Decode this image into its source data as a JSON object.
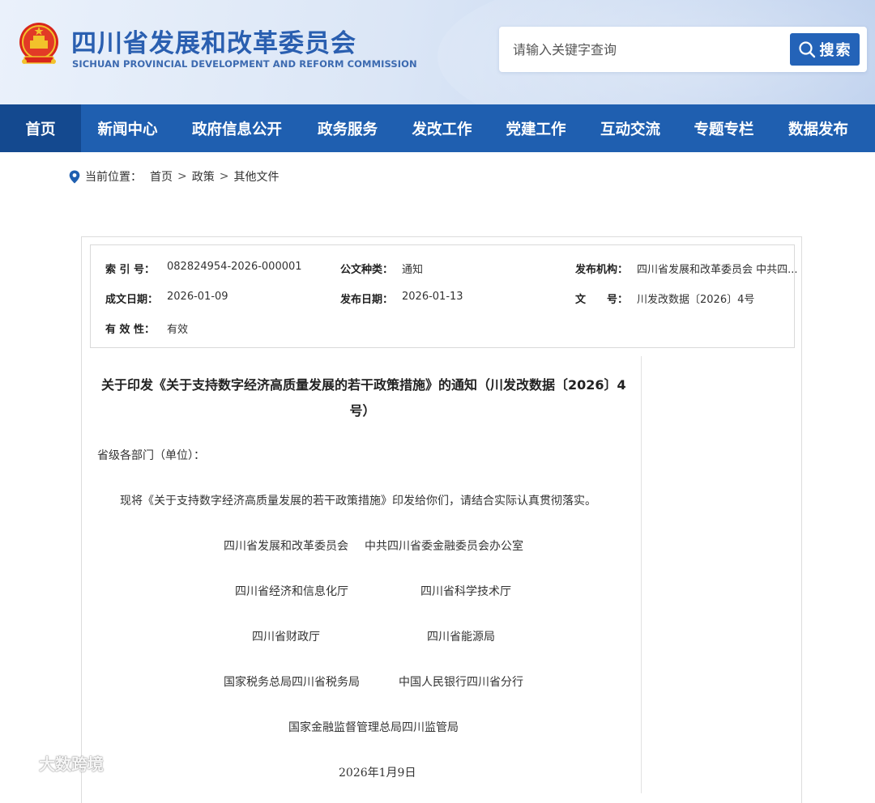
{
  "header": {
    "title": "四川省发展和改革委员会",
    "subtitle": "SICHUAN PROVINCIAL DEVELOPMENT AND REFORM COMMISSION",
    "emblem_icon": "national-emblem-icon",
    "search": {
      "placeholder": "请输入关键字查询",
      "button_label": "搜索"
    }
  },
  "nav": {
    "items": [
      {
        "label": "首页",
        "active": true
      },
      {
        "label": "新闻中心"
      },
      {
        "label": "政府信息公开"
      },
      {
        "label": "政务服务"
      },
      {
        "label": "发改工作"
      },
      {
        "label": "党建工作"
      },
      {
        "label": "互动交流"
      },
      {
        "label": "专题专栏"
      },
      {
        "label": "数据发布"
      }
    ]
  },
  "breadcrumb": {
    "prefix": "当前位置：",
    "items": [
      "首页",
      "政策",
      "其他文件"
    ],
    "separator": ">"
  },
  "meta": {
    "index_no_label": "索 引 号：",
    "index_no": "082824954-2026-000001",
    "doc_type_label": "公文种类：",
    "doc_type": "通知",
    "publisher_label": "发布机构：",
    "publisher": "四川省发展和改革委员会 中共四...",
    "created_label": "成文日期：",
    "created": "2026-01-09",
    "published_label": "发布日期：",
    "published": "2026-01-13",
    "doc_no_label": "文　　号：",
    "doc_no": "川发改数据〔2026〕4号",
    "validity_label": "有 效 性：",
    "validity": "有效"
  },
  "document": {
    "title_line1": "关于印发《关于支持数字经济高质量发展的若干政策措施》的通知（川发改数据〔2026〕4",
    "title_line2": "号）",
    "salutation": "省级各部门（单位）：",
    "body": "现将《关于支持数字经济高质量发展的若干政策措施》印发给你们，请结合实际认真贯彻落实。",
    "signatories": [
      [
        "四川省发展和改革委员会",
        "中共四川省委金融委员会办公室"
      ],
      [
        "四川省经济和信息化厅",
        "四川省科学技术厅"
      ],
      [
        "四川省财政厅",
        "四川省能源局"
      ],
      [
        "国家税务总局四川省税务局",
        "中国人民银行四川省分行"
      ],
      [
        "国家金融监督管理总局四川监管局"
      ]
    ],
    "date": "2026年1月9日"
  },
  "watermark": "大数跨境",
  "colors": {
    "nav_bg": "#1f5fb0",
    "nav_active_bg": "#14498f",
    "title_blue": "#2a5fb0",
    "search_button": "#2463b8"
  }
}
